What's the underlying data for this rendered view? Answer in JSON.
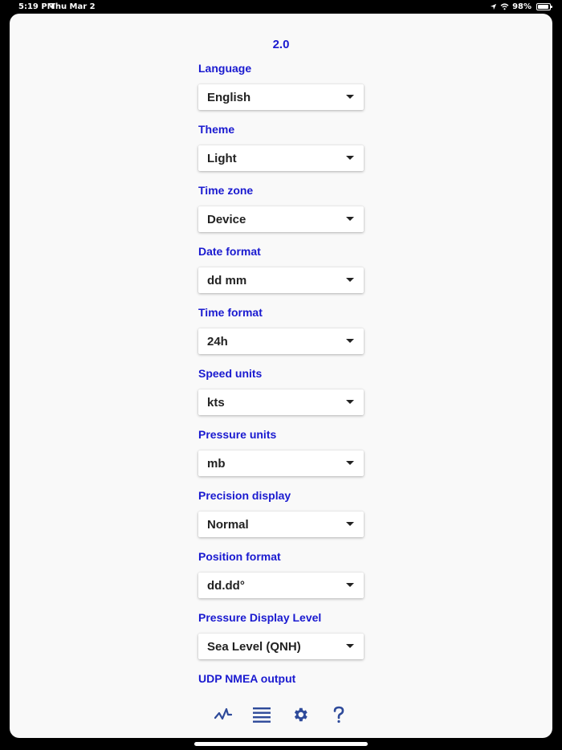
{
  "status_bar": {
    "time": "5:19 PM",
    "date": "Thu Mar 2",
    "battery": "98%",
    "icons": [
      "location-arrow-icon",
      "wifi-icon",
      "battery-icon"
    ]
  },
  "version": "2.0",
  "settings": [
    {
      "label": "Language",
      "value": "English"
    },
    {
      "label": "Theme",
      "value": "Light"
    },
    {
      "label": "Time zone",
      "value": "Device"
    },
    {
      "label": "Date format",
      "value": "dd mm"
    },
    {
      "label": "Time format",
      "value": "24h"
    },
    {
      "label": "Speed units",
      "value": "kts"
    },
    {
      "label": "Pressure units",
      "value": "mb"
    },
    {
      "label": "Precision display",
      "value": "Normal"
    },
    {
      "label": "Position format",
      "value": "dd.dd°"
    },
    {
      "label": "Pressure Display Level",
      "value": "Sea Level (QNH)"
    }
  ],
  "udp_label": "UDP NMEA output",
  "bottom_nav": [
    "chart-icon",
    "list-icon",
    "settings-gear-icon",
    "help-question-icon"
  ],
  "colors": {
    "accent": "#1a1ad0",
    "nav_icon": "#2e4a9a",
    "background": "#f9f9f9"
  }
}
